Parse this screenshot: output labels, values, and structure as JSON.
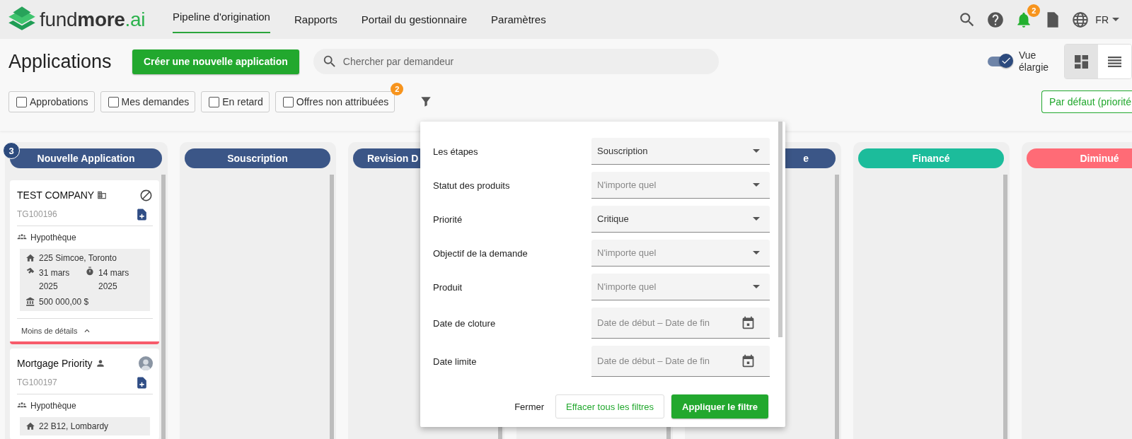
{
  "header": {
    "logo": [
      {
        "kind": "plain",
        "text": "fund"
      },
      {
        "kind": "bold",
        "text": "more"
      },
      {
        "kind": "accent",
        "text": ".ai"
      }
    ],
    "nav": [
      {
        "label": "Pipeline d'origination",
        "selected": true
      },
      {
        "label": "Rapports",
        "selected": false
      },
      {
        "label": "Portail du gestionnaire",
        "selected": false
      },
      {
        "label": "Paramètres",
        "selected": false
      }
    ],
    "notification_count": "2",
    "language": "FR"
  },
  "toolbar": {
    "title": "Applications",
    "create_button": "Créer une nouvelle application",
    "search": {
      "placeholder": "Chercher par demandeur"
    },
    "wide_view": {
      "label": "Vue élargie",
      "on": true
    },
    "view_modes": [
      {
        "kind": "grid",
        "selected": true
      },
      {
        "kind": "list",
        "selected": false
      }
    ]
  },
  "quick_filters": [
    {
      "label": "Approbations",
      "checked": false
    },
    {
      "label": "Mes demandes",
      "checked": false
    },
    {
      "label": "En retard",
      "checked": false
    },
    {
      "label": "Offres non attribuées",
      "checked": false,
      "badge": "2"
    }
  ],
  "sort_button": "Par défaut (priorité",
  "columns": [
    {
      "label": "Nouvelle Application",
      "color": "#3b5687",
      "count": "3",
      "cards": [
        {
          "title": "TEST COMPANY",
          "kind": "company",
          "id": "TG100196",
          "product": "Hypothèque",
          "address": "225 Simcoe, Toronto",
          "closing_date": "31 mars 2025",
          "deadline": "14 mars 2025",
          "amount": "500 000,00 $",
          "details_toggle": "Moins de détails",
          "color": "#f75b6b"
        },
        {
          "title": "Mortgage Priority",
          "kind": "person",
          "id": "TG100197",
          "product": "Hypothèque",
          "address": "22 B12, Lombardy"
        }
      ]
    },
    {
      "label": "Souscription",
      "color": "#3b5687"
    },
    {
      "label": "Revision D",
      "color": "#3b5687",
      "kind": "clipped_right"
    },
    {},
    {
      "label": "e",
      "color": "#3b5687",
      "kind": "clipped_left"
    },
    {
      "label": "Financé",
      "color": "#1cbc9b"
    },
    {
      "label": "Diminué",
      "color": "#ff6b76"
    }
  ],
  "filter_panel": {
    "rows": [
      {
        "label": "Les étapes",
        "kind": "select",
        "value": "Souscription"
      },
      {
        "label": "Statut des produits",
        "kind": "select",
        "placeholder": "N'importe quel"
      },
      {
        "label": "Priorité",
        "kind": "select",
        "value": "Critique"
      },
      {
        "label": "Objectif de la demande",
        "kind": "select",
        "placeholder": "N'importe quel"
      },
      {
        "label": "Produit",
        "kind": "select",
        "placeholder": "N'importe quel"
      },
      {
        "label": "Date de cloture",
        "kind": "date_range",
        "placeholder": "Date de début – Date de fin"
      },
      {
        "label": "Date limite",
        "kind": "date_range",
        "placeholder": "Date de début – Date de fin"
      }
    ],
    "close_button": "Fermer",
    "clear_button": "Effacer tous les filtres",
    "apply_button": "Appliquer le filtre"
  }
}
